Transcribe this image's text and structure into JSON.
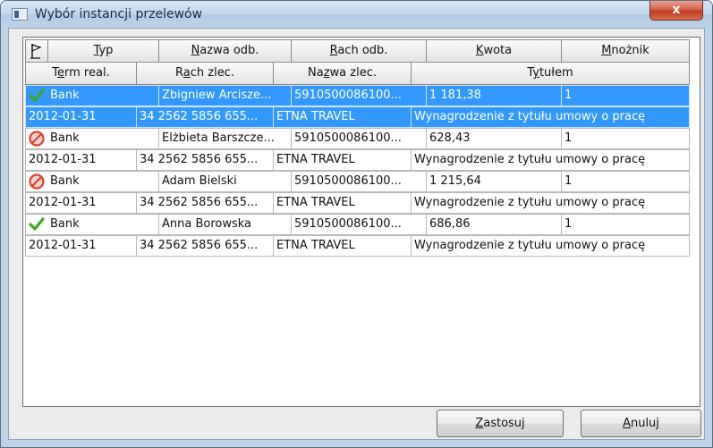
{
  "window": {
    "title": "Wybór instancji przelewów",
    "close_symbol": "x"
  },
  "header": {
    "row1": [
      {
        "key": "sort",
        "label": "",
        "icon": "flag-icon"
      },
      {
        "key": "typ",
        "mn": "T",
        "rest": "yp"
      },
      {
        "key": "nazwa_odb",
        "mn": "N",
        "rest": "azwa odb."
      },
      {
        "key": "rach_odb",
        "mn": "R",
        "rest": "ach odb."
      },
      {
        "key": "kwota",
        "mn": "K",
        "rest": "wota"
      },
      {
        "key": "mnoznik",
        "mn": "M",
        "rest": "nożnik"
      }
    ],
    "row2": [
      {
        "key": "term_real",
        "pre": "T",
        "mn": "e",
        "rest": "rm real."
      },
      {
        "key": "rach_zlec",
        "pre": "R",
        "mn": "a",
        "rest": "ch zlec."
      },
      {
        "key": "nazwa_zlec",
        "pre": "Na",
        "mn": "z",
        "rest": "wa zlec."
      },
      {
        "key": "tytulem",
        "pre": "T",
        "mn": "y",
        "rest": "tułem"
      }
    ]
  },
  "rows": [
    {
      "status": "check-icon",
      "typ": "Bank",
      "nazwa_odb": "Zbigniew Arcisze...",
      "rach_odb": "5910500086100...",
      "kwota": "1 181,38",
      "mnoznik": "1",
      "term_real": "2012-01-31",
      "rach_zlec": "34 2562 5856 655...",
      "nazwa_zlec": "ETNA TRAVEL",
      "tytulem": "Wynagrodzenie z tytułu umowy o pracę",
      "selected": true
    },
    {
      "status": "blocked-icon",
      "typ": "Bank",
      "nazwa_odb": "Elżbieta Barszcze...",
      "rach_odb": "5910500086100...",
      "kwota": "628,43",
      "mnoznik": "1",
      "term_real": "2012-01-31",
      "rach_zlec": "34 2562 5856 655...",
      "nazwa_zlec": "ETNA TRAVEL",
      "tytulem": "Wynagrodzenie z tytułu umowy o pracę",
      "selected": false
    },
    {
      "status": "blocked-icon",
      "typ": "Bank",
      "nazwa_odb": "Adam Bielski",
      "rach_odb": "5910500086100...",
      "kwota": "1 215,64",
      "mnoznik": "1",
      "term_real": "2012-01-31",
      "rach_zlec": "34 2562 5856 655...",
      "nazwa_zlec": "ETNA TRAVEL",
      "tytulem": "Wynagrodzenie z tytułu umowy o pracę",
      "selected": false
    },
    {
      "status": "check-icon",
      "typ": "Bank",
      "nazwa_odb": "Anna Borowska",
      "rach_odb": "5910500086100...",
      "kwota": "686,86",
      "mnoznik": "1",
      "term_real": "2012-01-31",
      "rach_zlec": "34 2562 5856 655...",
      "nazwa_zlec": "ETNA TRAVEL",
      "tytulem": "Wynagrodzenie z tytułu umowy o pracę",
      "selected": false
    }
  ],
  "buttons": {
    "zastosuj": {
      "mn": "Z",
      "rest": "astosuj"
    },
    "anuluj": {
      "mn": "A",
      "rest": "nuluj"
    }
  },
  "colors": {
    "selection": "#3399ff",
    "check": "#3aa81b",
    "blocked": "#d9452e"
  }
}
